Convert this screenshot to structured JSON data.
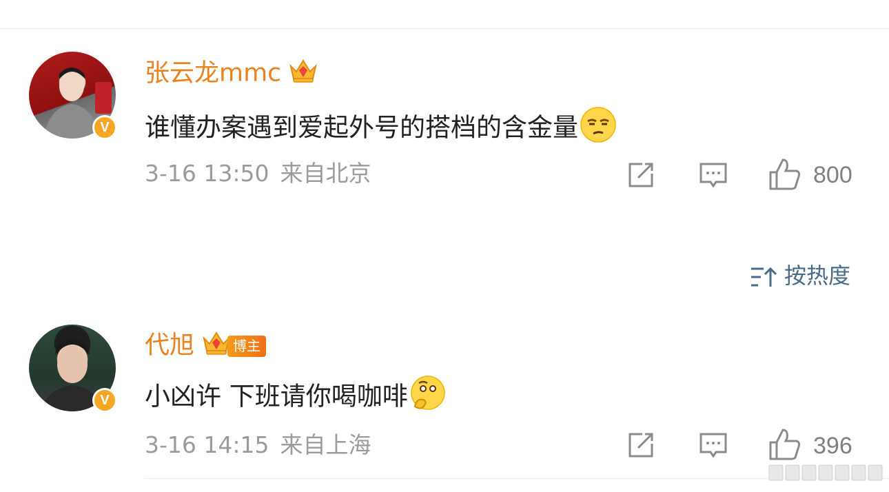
{
  "comments": [
    {
      "username": "张云龙mmc",
      "text": "谁懂办案遇到爱起外号的搭档的含金量",
      "time": "3-16 13:50",
      "location": "来自北京",
      "likes": "800",
      "verified_badge": "V",
      "emoji": "unamused-face"
    },
    {
      "username": "代旭",
      "badge": "博主",
      "text": "小凶许 下班请你喝咖啡",
      "time": "3-16 14:15",
      "location": "来自上海",
      "likes": "396",
      "verified_badge": "V",
      "emoji": "thinking-face"
    }
  ],
  "sort": {
    "label": "按热度"
  },
  "colors": {
    "username": "#e8831f",
    "badge_bg": "#f39a1a",
    "meta": "#9b9b9b",
    "sort": "#4a6a8a"
  }
}
